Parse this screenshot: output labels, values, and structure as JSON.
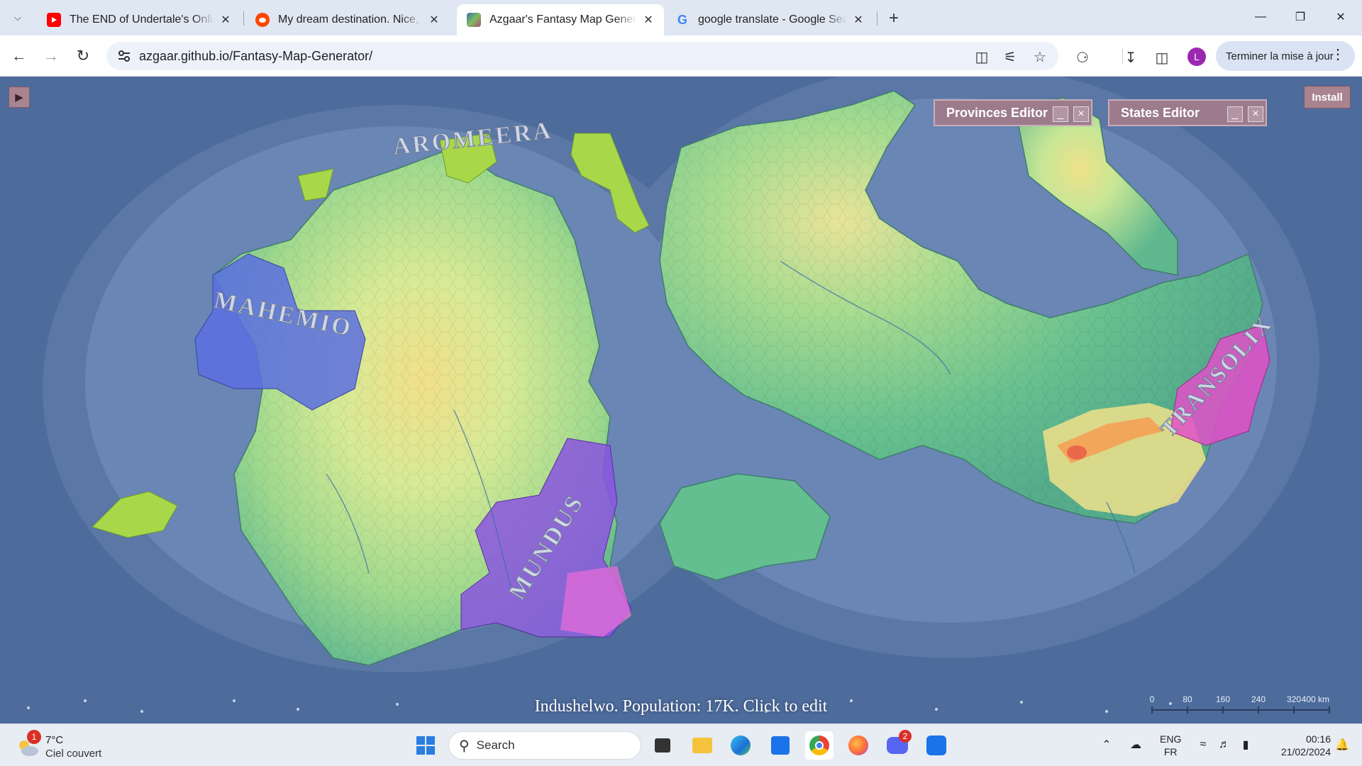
{
  "browser": {
    "tabs": [
      {
        "title": "The END of Undertale's Online P",
        "icon": "youtube-icon",
        "active": false
      },
      {
        "title": "My dream destination. Nice, Fra",
        "icon": "reddit-icon",
        "active": false
      },
      {
        "title": "Azgaar's Fantasy Map Generator",
        "icon": "azgaar-icon",
        "active": true
      },
      {
        "title": "google translate - Google Searc",
        "icon": "google-icon",
        "active": false
      }
    ],
    "url": "azgaar.github.io/Fantasy-Map-Generator/",
    "profile_initial": "L",
    "update_button": "Terminer la mise à jour"
  },
  "map_app": {
    "menu_toggle": "▶",
    "install_label": "Install",
    "editors": [
      {
        "title": "Provinces Editor",
        "minimize": "_",
        "close": "×"
      },
      {
        "title": "States Editor",
        "minimize": "_",
        "close": "×"
      }
    ],
    "state_labels": [
      "AROMEERA",
      "MAHEMIO",
      "MUNDUS",
      "TRANSOLIX"
    ],
    "tooltip": "Indushelwo. Population: 17K. Click to edit",
    "scale_bar": {
      "ticks": [
        "0",
        "80",
        "160",
        "240",
        "320",
        "400 km"
      ]
    },
    "colors": {
      "ocean": "#4d6b9b",
      "coast_shallow": "#6f8cba",
      "lowland": "#63bf90",
      "upland": "#c8e89a",
      "highland": "#f2ea9a",
      "peak": "#e9674b",
      "state_mahemio": "#5a6ee0",
      "state_mundus": "#8a55e0",
      "state_transolix": "#e050c8",
      "state_aromeera": "#a8d84a"
    }
  },
  "taskbar": {
    "weather_temp": "7°C",
    "weather_condition": "Ciel couvert",
    "weather_badge": "1",
    "search_label": "Search",
    "discord_badge": "2",
    "lang_top": "ENG",
    "lang_bottom": "FR",
    "time": "00:16",
    "date": "21/02/2024"
  }
}
